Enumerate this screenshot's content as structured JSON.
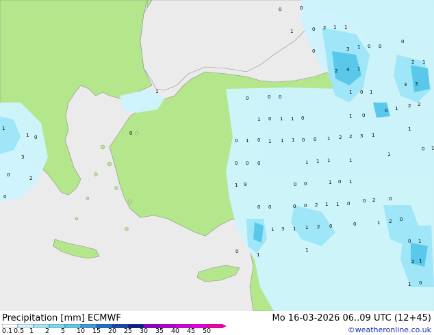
{
  "map": {
    "colors": {
      "sea": "#ebebeb",
      "land": "#b4e68c",
      "border": "#8c8c8c",
      "precip_light": "#cdf4ff",
      "precip_medium": "#9fe6f8",
      "precip_heavy": "#5ac8eb"
    },
    "grid_values": [
      "0",
      "0",
      "1",
      "0",
      "2",
      "1",
      "1",
      "0",
      "3",
      "1",
      "0",
      "0",
      "0",
      "2",
      "4",
      "1",
      "3",
      "1",
      "0",
      "1",
      "1",
      "2",
      "2",
      "3",
      "1",
      "0",
      "0",
      "0",
      "1",
      "0",
      "1",
      "1",
      "0",
      "0",
      "1",
      "0",
      "0",
      "0",
      "1",
      "9",
      "0",
      "0",
      "0",
      "0",
      "2",
      "1",
      "1",
      "0",
      "1",
      "3",
      "1",
      "1",
      "2",
      "0",
      "0",
      "1",
      "0",
      "2",
      "1",
      "0",
      "1",
      "2",
      "1",
      "0",
      "1",
      "0",
      "0",
      "0",
      "1",
      "0",
      "3",
      "1",
      "2",
      "1",
      "0",
      "2",
      "1",
      "3",
      "2",
      "0",
      "1",
      "2",
      "1",
      "0",
      "1",
      "1",
      "0",
      "1",
      "1",
      "1",
      "0",
      "0",
      "0",
      "1",
      "1",
      "1",
      "0",
      "0",
      "1",
      "0",
      "1",
      "1",
      "1",
      "0",
      "2",
      "0",
      "1"
    ]
  },
  "legend": {
    "title": "Precipitation [mm]  ECMWF",
    "datetime": "Mo 16-03-2026 06..09 UTC (12+45)",
    "credit": "©weatheronline.co.uk",
    "labels": [
      "0.1",
      "0.5",
      "1",
      "2",
      "5",
      "10",
      "15",
      "20",
      "25",
      "30",
      "35",
      "40",
      "45",
      "50"
    ],
    "colors": [
      "#ffffff",
      "#cdf4ff",
      "#9fe6f8",
      "#78d7f0",
      "#5ac8eb",
      "#3c9be1",
      "#1e6ed2",
      "#1446b4",
      "#0a1e96",
      "#8c00c8",
      "#b400d2",
      "#d200dc",
      "#e600e6",
      "#f000aa"
    ]
  }
}
